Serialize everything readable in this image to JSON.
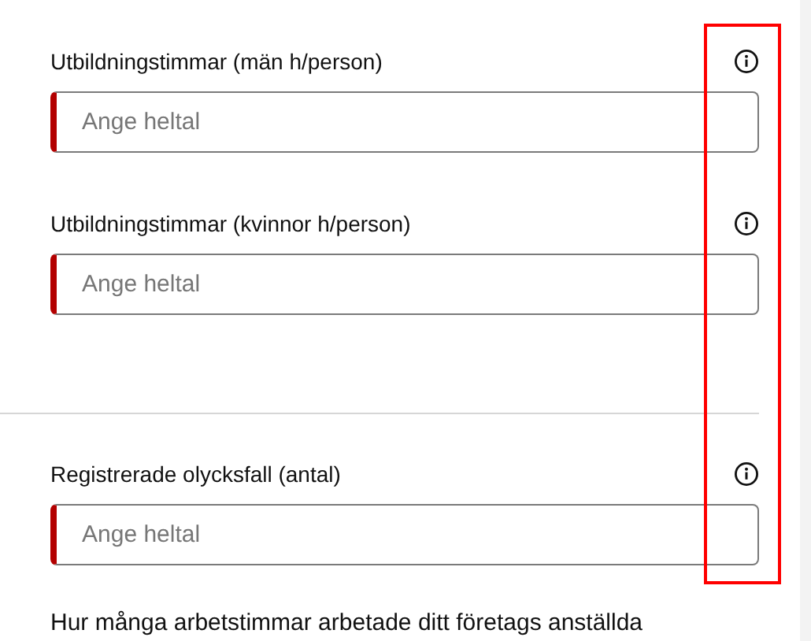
{
  "sections": [
    {
      "fields": [
        {
          "label": "Utbildningstimmar (män h/person)",
          "placeholder": "Ange heltal",
          "invalid": true
        },
        {
          "label": "Utbildningstimmar (kvinnor h/person)",
          "placeholder": "Ange heltal",
          "invalid": true
        }
      ]
    },
    {
      "fields": [
        {
          "label": "Registrerade olycksfall (antal)",
          "placeholder": "Ange heltal",
          "invalid": true
        }
      ]
    }
  ],
  "next_question": "Hur många arbetstimmar arbetade ditt företags anställda",
  "highlight_box": true
}
